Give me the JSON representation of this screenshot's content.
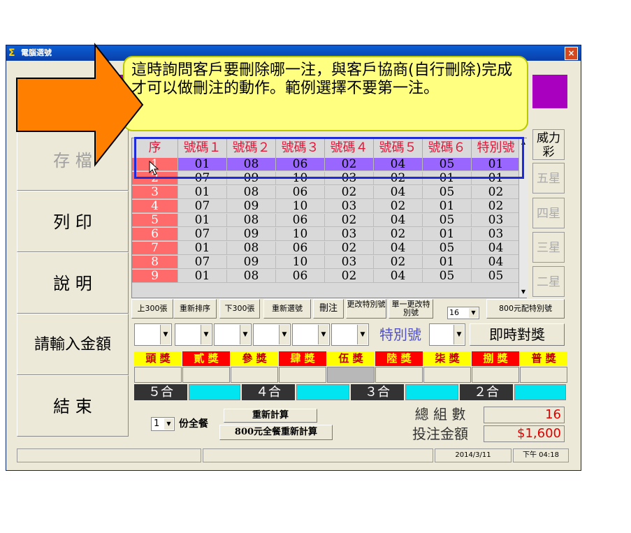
{
  "window": {
    "title": "電腦選號",
    "close_label": "×"
  },
  "sidebar": {
    "buttons": [
      {
        "label": "存 檔"
      },
      {
        "label": "列 印"
      },
      {
        "label": "說 明"
      },
      {
        "label": "請輸入金額"
      },
      {
        "label": "結 束"
      }
    ]
  },
  "grid": {
    "headers": [
      "序",
      "號碼１",
      "號碼２",
      "號碼３",
      "號碼４",
      "號碼５",
      "號碼６",
      "特別號"
    ],
    "rows": [
      [
        "1",
        "01",
        "08",
        "06",
        "02",
        "04",
        "05",
        "01"
      ],
      [
        "2",
        "07",
        "09",
        "10",
        "03",
        "02",
        "01",
        "01"
      ],
      [
        "3",
        "01",
        "08",
        "06",
        "02",
        "04",
        "05",
        "02"
      ],
      [
        "4",
        "07",
        "09",
        "10",
        "03",
        "02",
        "01",
        "02"
      ],
      [
        "5",
        "01",
        "08",
        "06",
        "02",
        "04",
        "05",
        "03"
      ],
      [
        "6",
        "07",
        "09",
        "10",
        "03",
        "02",
        "01",
        "03"
      ],
      [
        "7",
        "01",
        "08",
        "06",
        "02",
        "04",
        "05",
        "04"
      ],
      [
        "8",
        "07",
        "09",
        "10",
        "03",
        "02",
        "01",
        "04"
      ],
      [
        "9",
        "01",
        "08",
        "06",
        "02",
        "04",
        "05",
        "05"
      ]
    ],
    "selected_row": 0
  },
  "game_tabs": [
    {
      "label": "威力彩",
      "active": true
    },
    {
      "label": "五星",
      "active": false
    },
    {
      "label": "四星",
      "active": false
    },
    {
      "label": "三星",
      "active": false
    },
    {
      "label": "二星",
      "active": false
    }
  ],
  "toolbar": {
    "up300": "上300張",
    "resort": "重新排序",
    "down300": "下300張",
    "reselect": "重新選號",
    "delete": "刪注",
    "change_special": "更改特別號",
    "change_one_special": "單一更改特別號",
    "count_value": "16",
    "match800": "800元配特別號"
  },
  "picker": {
    "special_label": "特別號",
    "instant_check": "即時對獎"
  },
  "prizes": [
    {
      "label": "頭 獎",
      "bg": "#ffff00",
      "color": "#c00000"
    },
    {
      "label": "貳 獎",
      "bg": "#ff0000",
      "color": "#ffff00"
    },
    {
      "label": "參 獎",
      "bg": "#ffff00",
      "color": "#c00000"
    },
    {
      "label": "肆 獎",
      "bg": "#ff0000",
      "color": "#ffff00"
    },
    {
      "label": "伍 獎",
      "bg": "#ffff00",
      "color": "#c00000"
    },
    {
      "label": "陸 獎",
      "bg": "#ff0000",
      "color": "#ffff00"
    },
    {
      "label": "柒 獎",
      "bg": "#ffff00",
      "color": "#c00000"
    },
    {
      "label": "捌 獎",
      "bg": "#ff0000",
      "color": "#ffff00"
    },
    {
      "label": "普 獎",
      "bg": "#ffff00",
      "color": "#c00000"
    }
  ],
  "combos": [
    {
      "label": "５合"
    },
    {
      "label": "４合"
    },
    {
      "label": "３合"
    },
    {
      "label": "２合"
    }
  ],
  "bottom": {
    "portion_value": "1",
    "portion_label": "份全餐",
    "recalc": "重新計算",
    "recalc800": "800元全餐重新計算",
    "total_groups_label": "總 組 數",
    "total_groups_value": "16",
    "bet_amount_label": "投注金額",
    "bet_amount_value": "$1,600"
  },
  "status": {
    "date": "2014/3/11",
    "time": "下午 04:18"
  },
  "callout": {
    "text": "這時詢問客戶要刪除哪一注，與客戶協商(自行刪除)完成才可以做刪注的動作。範例選擇不要第一注。"
  },
  "colors": {
    "accent_purple": "#a900c0",
    "selected_row": "#9966ff",
    "seq_red": "#ff6b6b",
    "arrow_orange": "#ff7f00",
    "cyan": "#00e5f0"
  }
}
